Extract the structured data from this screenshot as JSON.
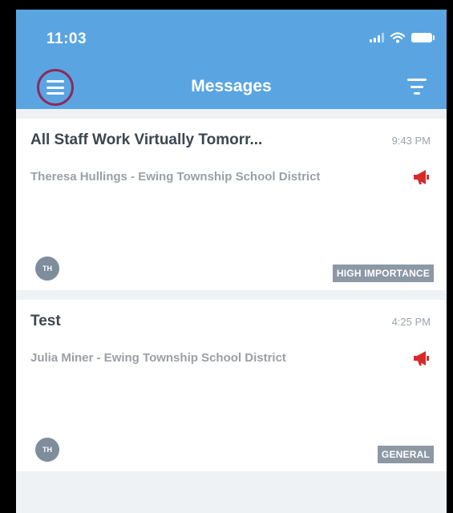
{
  "status_bar": {
    "time": "11:03"
  },
  "header": {
    "title": "Messages"
  },
  "messages": [
    {
      "title": "All Staff Work Virtually Tomorr...",
      "time": "9:43 PM",
      "sender": "Theresa Hullings  - Ewing Township School District",
      "avatar": "TH",
      "badge": "HIGH IMPORTANCE"
    },
    {
      "title": "Test",
      "time": "4:25 PM",
      "sender": "Julia Miner - Ewing Township School District",
      "avatar": "TH",
      "badge": "GENERAL"
    }
  ],
  "colors": {
    "header": "#5aa5e1",
    "menu_highlight": "#8c2a5c",
    "megaphone": "#d62b2b",
    "badge": "#8c98a4"
  }
}
